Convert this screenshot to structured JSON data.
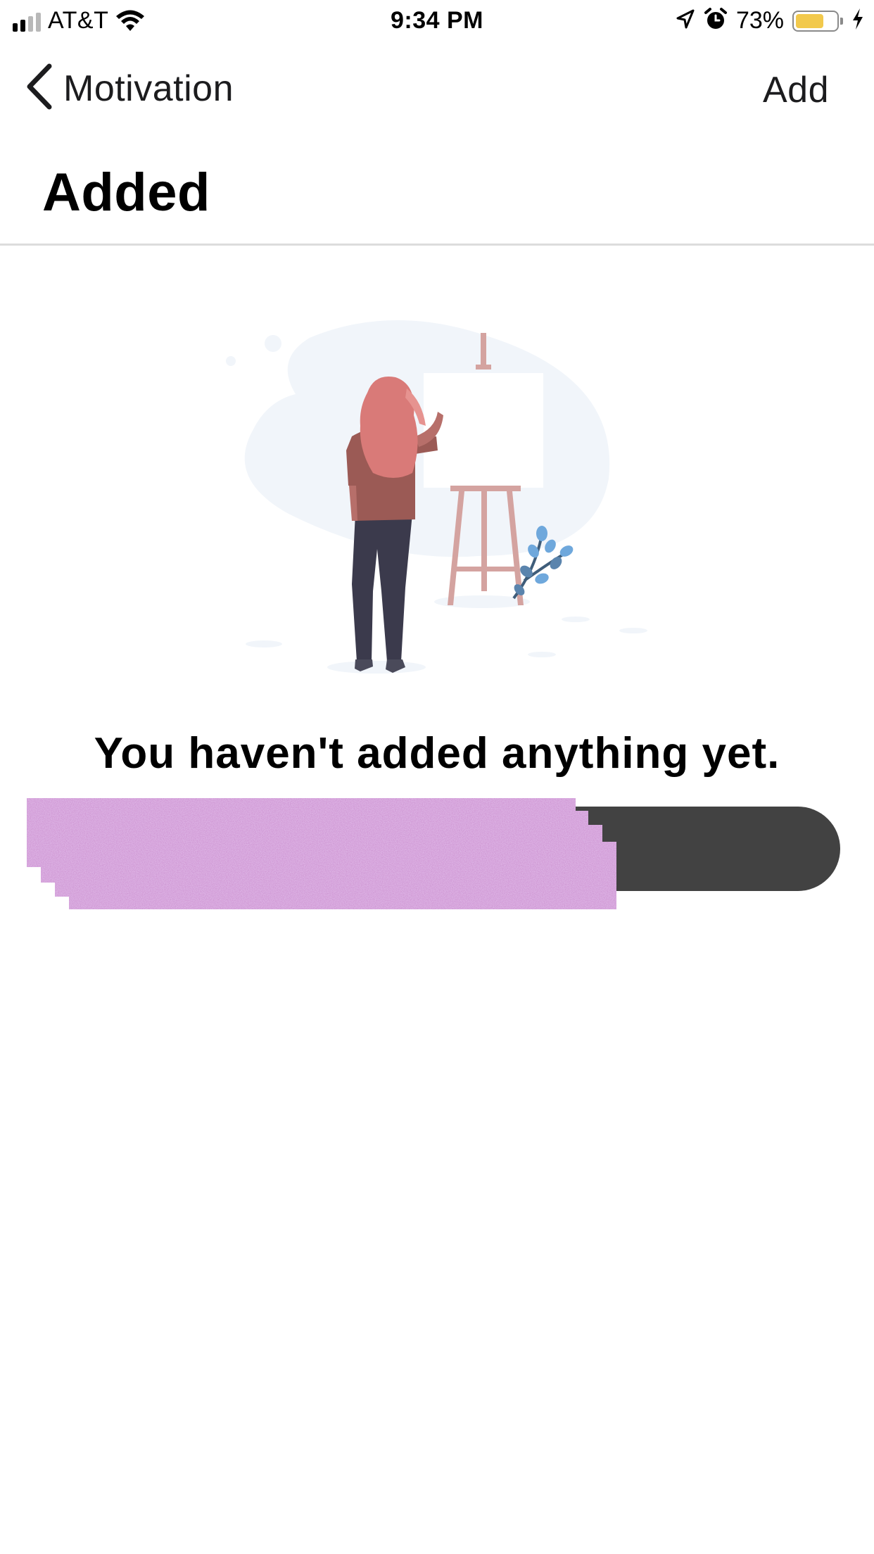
{
  "status_bar": {
    "carrier": "AT&T",
    "time": "9:34 PM",
    "battery_percent": "73%",
    "battery_level": 0.73,
    "icons": [
      "signal-icon",
      "wifi-icon",
      "location-arrow-icon",
      "alarm-icon",
      "battery-icon",
      "charging-bolt-icon"
    ]
  },
  "nav": {
    "back_label": "Motivation",
    "add_label": "Add",
    "back_icon": "chevron-left-icon"
  },
  "page": {
    "title": "Added"
  },
  "empty_state": {
    "illustration": "woman-at-easel-illustration",
    "message": "You haven't added anything yet."
  },
  "colors": {
    "button_bg": "#424242",
    "battery_fill": "#f2c94c",
    "hair": "#d97a78",
    "shirt": "#9b5a55",
    "pants": "#3b3a4c",
    "easel": "#d4a3a0",
    "plant_leaf": "#6fa8dc",
    "blob": "#f1f5fa"
  }
}
